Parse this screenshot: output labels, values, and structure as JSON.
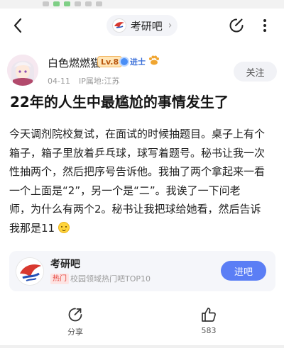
{
  "topbar": {
    "back_icon": "chevron-left-icon",
    "forum_pill_label": "考研吧",
    "forum_chevron": "›",
    "edit_icon": "edit-icon",
    "more_icon": "more-vertical-icon"
  },
  "author": {
    "name": "白色燃燃猫",
    "level": "Lv.8",
    "badge": "进士",
    "date": "04-11",
    "ip": "IP属地:江苏",
    "follow_label": "关注"
  },
  "post": {
    "title": "22年的人生中最尴尬的事情发生了",
    "lines": [
      "今天调剂院校复试，在面试的时候抽题目。桌子上有个",
      "箱子，箱子里放着乒乓球，球写着题号。秘书让我一次",
      "性抽两个，然后把序号告诉他。我抽了两个拿起来一看",
      "一个上面是“2”，另一个是“二”。我诶了一下问老",
      "师，为什么有两个2。秘书让我把球给她看，然后告诉",
      "我那是11"
    ]
  },
  "forum_card": {
    "name": "考研吧",
    "hot_tag": "热门",
    "rank_text": "校园领域热门吧TOP10",
    "join_label": "进吧"
  },
  "actions": {
    "share_label": "分享",
    "like_count": "583"
  },
  "colors": {
    "accent": "#5b7ef5",
    "hot_red": "#e5463f",
    "level_orange": "#f2b35c"
  }
}
